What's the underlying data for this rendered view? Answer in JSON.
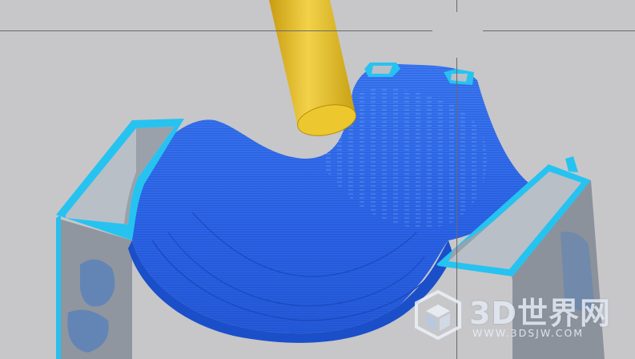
{
  "viewport": {
    "background": "#c7c7c9",
    "crosshair_color": "#6a6a6a"
  },
  "scene": {
    "tool_color": "#e0bc1c",
    "toolpath_color": "#2f6ff0",
    "rim_color": "#1ec7f2",
    "wall_color": "#8c939c"
  },
  "watermark": {
    "brand": "3D世界网",
    "url": "WWW.3DSJW.COM",
    "logo_icon": "cube-logo-icon"
  }
}
